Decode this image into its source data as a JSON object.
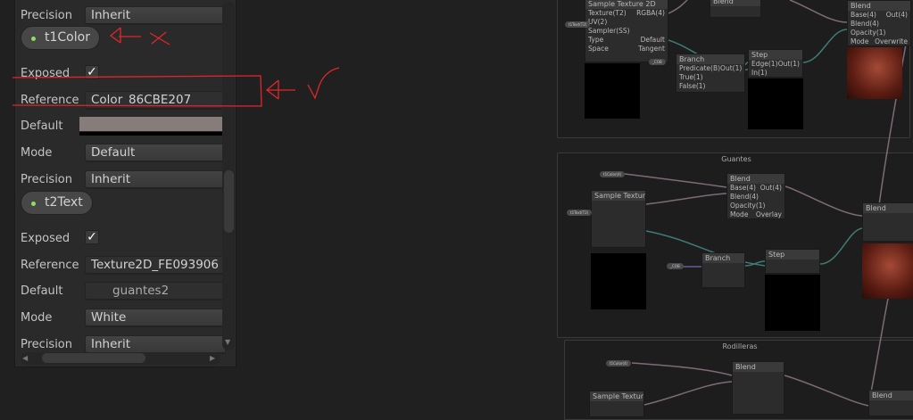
{
  "inspector": {
    "rows": [
      {
        "label": "Precision",
        "value": "Inherit",
        "kind": "dropdown"
      },
      {
        "property": "t1Color"
      },
      {
        "label": "Exposed",
        "checked": true,
        "kind": "checkbox"
      },
      {
        "label": "Reference",
        "value": "Color_86CBE207",
        "kind": "text"
      },
      {
        "label": "Default",
        "color": "#867d7b",
        "kind": "color"
      },
      {
        "label": "Mode",
        "value": "Default",
        "kind": "dropdown"
      },
      {
        "label": "Precision",
        "value": "Inherit",
        "kind": "dropdown"
      },
      {
        "property": "t2Text"
      },
      {
        "label": "Exposed",
        "checked": true,
        "kind": "checkbox"
      },
      {
        "label": "Reference",
        "value": "Texture2D_FE093906",
        "kind": "text"
      },
      {
        "label": "Default",
        "value": "guantes2",
        "kind": "texture"
      },
      {
        "label": "Mode",
        "value": "White",
        "kind": "dropdown"
      },
      {
        "label": "Precision",
        "value": "Inherit",
        "kind": "dropdown"
      }
    ]
  },
  "graph": {
    "groups": [
      {
        "title": ""
      },
      {
        "title": "Guantes"
      },
      {
        "title": "Rodilleras"
      }
    ],
    "nodes": {
      "sample_texture": "Sample Texture 2D",
      "branch": "Branch",
      "step": "Step",
      "blend": "Blend"
    },
    "ports": {
      "texture": "Texture(T2)",
      "uv": "UV(2)",
      "sampler": "Sampler(SS)",
      "rgba": "RGBA(4)",
      "predicate": "Predicate(B)",
      "true": "True(1)",
      "false": "False(1)",
      "edge": "Edge(1)",
      "in": "In(1)",
      "out": "Out(1)",
      "out4": "Out(4)",
      "base": "Base(4)",
      "blend": "Blend(4)",
      "opacity": "Opacity(1)",
      "mode": "Mode",
      "overlay": "Overlay",
      "overwrite": "Overwrite",
      "type": "Type",
      "default": "Default",
      "space": "Space",
      "tangent": "Tangent"
    },
    "props": {
      "color": "t1Color(4)",
      "text": "t1Text(T2)",
      "bool": "_COB"
    }
  },
  "colors": {
    "annotation": "#e0262b",
    "accent_dot": "#8ee05a"
  }
}
